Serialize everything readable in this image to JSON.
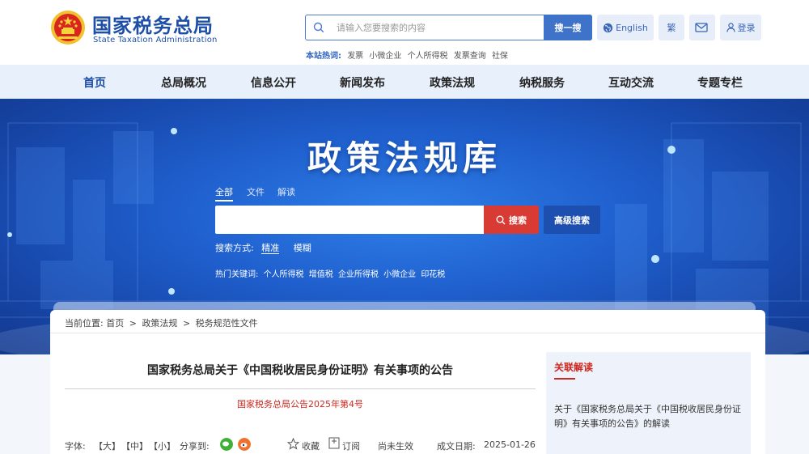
{
  "header": {
    "logo_cn": "国家税务总局",
    "logo_en": "State Taxation Administration",
    "search_placeholder": "请输入您要搜索的内容",
    "search_button": "搜一搜",
    "hot_label": "本站热词:",
    "hot_words": [
      "发票",
      "小微企业",
      "个人所得税",
      "发票查询",
      "社保"
    ],
    "english_label": "English",
    "traditional_label": "繁",
    "login_label": "登录"
  },
  "nav": {
    "items": [
      "首页",
      "总局概况",
      "信息公开",
      "新闻发布",
      "政策法规",
      "纳税服务",
      "互动交流",
      "专题专栏"
    ],
    "active_index": 0
  },
  "banner": {
    "title": "政策法规库",
    "scope_tabs": [
      "全部",
      "文件",
      "解读"
    ],
    "search_button": "搜索",
    "advanced_search": "高级搜索",
    "mode_label": "搜索方式:",
    "modes": [
      "精准",
      "模糊"
    ],
    "keywords_label": "热门关键词:",
    "keywords": [
      "个人所得税",
      "增值税",
      "企业所得税",
      "小微企业",
      "印花税"
    ]
  },
  "breadcrumb": {
    "label": "当前位置:",
    "items": [
      "首页",
      "政策法规",
      "税务规范性文件"
    ],
    "separator": ">"
  },
  "article": {
    "title": "国家税务总局关于《中国税收居民身份证明》有关事项的公告",
    "doc_number": "国家税务总局公告2025年第4号",
    "font_label": "字体:",
    "font_sizes": [
      "【大】",
      "【中】",
      "【小】"
    ],
    "share_label": "分享到:",
    "favorite": "收藏",
    "subscribe": "订阅",
    "status": "尚未生效",
    "date_label": "成文日期:",
    "date": "2025-01-26"
  },
  "sidebar": {
    "title": "关联解读",
    "link": "关于《国家税务总局关于《中国税收居民身份证明》有关事项的公告》的解读"
  },
  "colors": {
    "brand_blue": "#1e4fa8",
    "accent_red": "#d83a34",
    "nav_bg": "#e8f0fc"
  }
}
